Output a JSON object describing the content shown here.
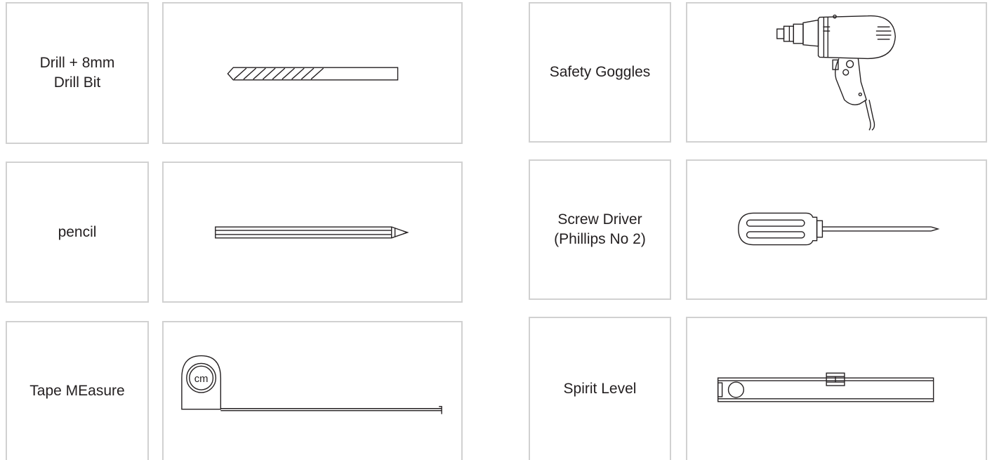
{
  "colors": {
    "border": "#d1d1d1",
    "line": "#231f20",
    "background": "#ffffff"
  },
  "tools": [
    {
      "label": "Drill + 8mm\nDrill Bit",
      "icon": "drill-bit-icon"
    },
    {
      "label": "Safety Goggles",
      "icon": "power-drill-icon"
    },
    {
      "label": "pencil",
      "icon": "pencil-icon"
    },
    {
      "label": "Screw Driver\n(Phillips No 2)",
      "icon": "screwdriver-icon"
    },
    {
      "label": "Tape MEasure",
      "icon": "tape-measure-icon",
      "icon_text": "cm"
    },
    {
      "label": "Spirit Level",
      "icon": "spirit-level-icon"
    }
  ]
}
